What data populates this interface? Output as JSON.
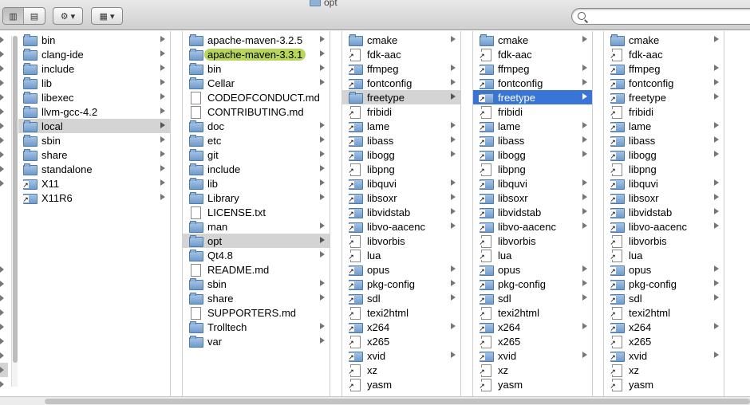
{
  "window": {
    "title": "opt"
  },
  "toolbar": {
    "view_icon_column": "▥",
    "view_icon_coverflow": "▤",
    "action_icon": "⚙",
    "arrange_icon": "▦",
    "dropdown_caret": "▾",
    "search_placeholder": ""
  },
  "columns": [
    {
      "items": [
        {
          "name": "bin",
          "type": "folder",
          "arrow": true
        },
        {
          "name": "clang-ide",
          "type": "folder",
          "arrow": true
        },
        {
          "name": "include",
          "type": "folder",
          "arrow": true
        },
        {
          "name": "lib",
          "type": "folder",
          "arrow": true
        },
        {
          "name": "libexec",
          "type": "folder",
          "arrow": true
        },
        {
          "name": "llvm-gcc-4.2",
          "type": "folder",
          "arrow": true
        },
        {
          "name": "local",
          "type": "folder",
          "arrow": true,
          "selected": "gray"
        },
        {
          "name": "sbin",
          "type": "folder",
          "arrow": true
        },
        {
          "name": "share",
          "type": "folder",
          "arrow": true
        },
        {
          "name": "standalone",
          "type": "folder",
          "arrow": true
        },
        {
          "name": "X11",
          "type": "alias-folder",
          "arrow": true
        },
        {
          "name": "X11R6",
          "type": "alias-folder",
          "arrow": true
        }
      ]
    },
    {
      "items": [
        {
          "name": "apache-maven-3.2.5",
          "type": "folder",
          "arrow": true
        },
        {
          "name": "apache-maven-3.3.1",
          "type": "folder",
          "arrow": true,
          "selected": "green"
        },
        {
          "name": "bin",
          "type": "folder",
          "arrow": true
        },
        {
          "name": "Cellar",
          "type": "folder",
          "arrow": true
        },
        {
          "name": "CODEOFCONDUCT.md",
          "type": "file",
          "arrow": false
        },
        {
          "name": "CONTRIBUTING.md",
          "type": "file",
          "arrow": false
        },
        {
          "name": "doc",
          "type": "folder",
          "arrow": true
        },
        {
          "name": "etc",
          "type": "folder",
          "arrow": true
        },
        {
          "name": "git",
          "type": "folder",
          "arrow": true
        },
        {
          "name": "include",
          "type": "folder",
          "arrow": true
        },
        {
          "name": "lib",
          "type": "folder",
          "arrow": true
        },
        {
          "name": "Library",
          "type": "folder",
          "arrow": true
        },
        {
          "name": "LICENSE.txt",
          "type": "file",
          "arrow": false
        },
        {
          "name": "man",
          "type": "folder",
          "arrow": true
        },
        {
          "name": "opt",
          "type": "folder",
          "arrow": true,
          "selected": "gray"
        },
        {
          "name": "Qt4.8",
          "type": "folder",
          "arrow": true
        },
        {
          "name": "README.md",
          "type": "file",
          "arrow": false
        },
        {
          "name": "sbin",
          "type": "folder",
          "arrow": true
        },
        {
          "name": "share",
          "type": "folder",
          "arrow": true
        },
        {
          "name": "SUPPORTERS.md",
          "type": "file",
          "arrow": false
        },
        {
          "name": "Trolltech",
          "type": "folder",
          "arrow": true
        },
        {
          "name": "var",
          "type": "folder",
          "arrow": true
        }
      ]
    },
    {
      "items": [
        {
          "name": "cmake",
          "type": "folder",
          "arrow": true
        },
        {
          "name": "fdk-aac",
          "type": "alias-file",
          "arrow": false
        },
        {
          "name": "ffmpeg",
          "type": "alias-folder",
          "arrow": true
        },
        {
          "name": "fontconfig",
          "type": "alias-folder",
          "arrow": true
        },
        {
          "name": "freetype",
          "type": "folder",
          "arrow": true,
          "selected": "gray"
        },
        {
          "name": "fribidi",
          "type": "alias-file",
          "arrow": false
        },
        {
          "name": "lame",
          "type": "alias-folder",
          "arrow": true
        },
        {
          "name": "libass",
          "type": "alias-folder",
          "arrow": true
        },
        {
          "name": "libogg",
          "type": "alias-folder",
          "arrow": true
        },
        {
          "name": "libpng",
          "type": "alias-file",
          "arrow": false
        },
        {
          "name": "libquvi",
          "type": "alias-folder",
          "arrow": true
        },
        {
          "name": "libsoxr",
          "type": "alias-folder",
          "arrow": true
        },
        {
          "name": "libvidstab",
          "type": "alias-folder",
          "arrow": true
        },
        {
          "name": "libvo-aacenc",
          "type": "alias-folder",
          "arrow": true
        },
        {
          "name": "libvorbis",
          "type": "alias-file",
          "arrow": false
        },
        {
          "name": "lua",
          "type": "alias-file",
          "arrow": false
        },
        {
          "name": "opus",
          "type": "alias-folder",
          "arrow": true
        },
        {
          "name": "pkg-config",
          "type": "alias-folder",
          "arrow": true
        },
        {
          "name": "sdl",
          "type": "alias-folder",
          "arrow": true
        },
        {
          "name": "texi2html",
          "type": "alias-file",
          "arrow": false
        },
        {
          "name": "x264",
          "type": "alias-folder",
          "arrow": true
        },
        {
          "name": "x265",
          "type": "alias-file",
          "arrow": false
        },
        {
          "name": "xvid",
          "type": "alias-folder",
          "arrow": true
        },
        {
          "name": "xz",
          "type": "alias-file",
          "arrow": false
        },
        {
          "name": "yasm",
          "type": "alias-file",
          "arrow": false
        }
      ]
    },
    {
      "items": [
        {
          "name": "cmake",
          "type": "folder",
          "arrow": true
        },
        {
          "name": "fdk-aac",
          "type": "alias-file",
          "arrow": false
        },
        {
          "name": "ffmpeg",
          "type": "alias-folder",
          "arrow": true
        },
        {
          "name": "fontconfig",
          "type": "alias-folder",
          "arrow": true
        },
        {
          "name": "freetype",
          "type": "alias-folder",
          "arrow": true,
          "selected": "blue"
        },
        {
          "name": "fribidi",
          "type": "alias-file",
          "arrow": false
        },
        {
          "name": "lame",
          "type": "alias-folder",
          "arrow": true
        },
        {
          "name": "libass",
          "type": "alias-folder",
          "arrow": true
        },
        {
          "name": "libogg",
          "type": "alias-folder",
          "arrow": true
        },
        {
          "name": "libpng",
          "type": "alias-file",
          "arrow": false
        },
        {
          "name": "libquvi",
          "type": "alias-folder",
          "arrow": true
        },
        {
          "name": "libsoxr",
          "type": "alias-folder",
          "arrow": true
        },
        {
          "name": "libvidstab",
          "type": "alias-folder",
          "arrow": true
        },
        {
          "name": "libvo-aacenc",
          "type": "alias-folder",
          "arrow": true
        },
        {
          "name": "libvorbis",
          "type": "alias-file",
          "arrow": false
        },
        {
          "name": "lua",
          "type": "alias-file",
          "arrow": false
        },
        {
          "name": "opus",
          "type": "alias-folder",
          "arrow": true
        },
        {
          "name": "pkg-config",
          "type": "alias-folder",
          "arrow": true
        },
        {
          "name": "sdl",
          "type": "alias-folder",
          "arrow": true
        },
        {
          "name": "texi2html",
          "type": "alias-file",
          "arrow": false
        },
        {
          "name": "x264",
          "type": "alias-folder",
          "arrow": true
        },
        {
          "name": "x265",
          "type": "alias-file",
          "arrow": false
        },
        {
          "name": "xvid",
          "type": "alias-folder",
          "arrow": true
        },
        {
          "name": "xz",
          "type": "alias-file",
          "arrow": false
        },
        {
          "name": "yasm",
          "type": "alias-file",
          "arrow": false
        }
      ]
    },
    {
      "items": [
        {
          "name": "cmake",
          "type": "folder",
          "arrow": true
        },
        {
          "name": "fdk-aac",
          "type": "alias-file",
          "arrow": false
        },
        {
          "name": "ffmpeg",
          "type": "alias-folder",
          "arrow": true
        },
        {
          "name": "fontconfig",
          "type": "alias-folder",
          "arrow": true
        },
        {
          "name": "freetype",
          "type": "alias-folder",
          "arrow": true
        },
        {
          "name": "fribidi",
          "type": "alias-file",
          "arrow": false
        },
        {
          "name": "lame",
          "type": "alias-folder",
          "arrow": true
        },
        {
          "name": "libass",
          "type": "alias-folder",
          "arrow": true
        },
        {
          "name": "libogg",
          "type": "alias-folder",
          "arrow": true
        },
        {
          "name": "libpng",
          "type": "alias-file",
          "arrow": false
        },
        {
          "name": "libquvi",
          "type": "alias-folder",
          "arrow": true
        },
        {
          "name": "libsoxr",
          "type": "alias-folder",
          "arrow": true
        },
        {
          "name": "libvidstab",
          "type": "alias-folder",
          "arrow": true
        },
        {
          "name": "libvo-aacenc",
          "type": "alias-folder",
          "arrow": true
        },
        {
          "name": "libvorbis",
          "type": "alias-file",
          "arrow": false
        },
        {
          "name": "lua",
          "type": "alias-file",
          "arrow": false
        },
        {
          "name": "opus",
          "type": "alias-folder",
          "arrow": true
        },
        {
          "name": "pkg-config",
          "type": "alias-folder",
          "arrow": true
        },
        {
          "name": "sdl",
          "type": "alias-folder",
          "arrow": true
        },
        {
          "name": "texi2html",
          "type": "alias-file",
          "arrow": false
        },
        {
          "name": "x264",
          "type": "alias-folder",
          "arrow": true
        },
        {
          "name": "x265",
          "type": "alias-file",
          "arrow": false
        },
        {
          "name": "xvid",
          "type": "alias-folder",
          "arrow": true
        },
        {
          "name": "xz",
          "type": "alias-file",
          "arrow": false
        },
        {
          "name": "yasm",
          "type": "alias-file",
          "arrow": false
        }
      ]
    }
  ],
  "colors": {
    "selection_active": "#3875d7",
    "selection_inactive": "#d4d4d4",
    "label_green": "#b6d55a"
  }
}
